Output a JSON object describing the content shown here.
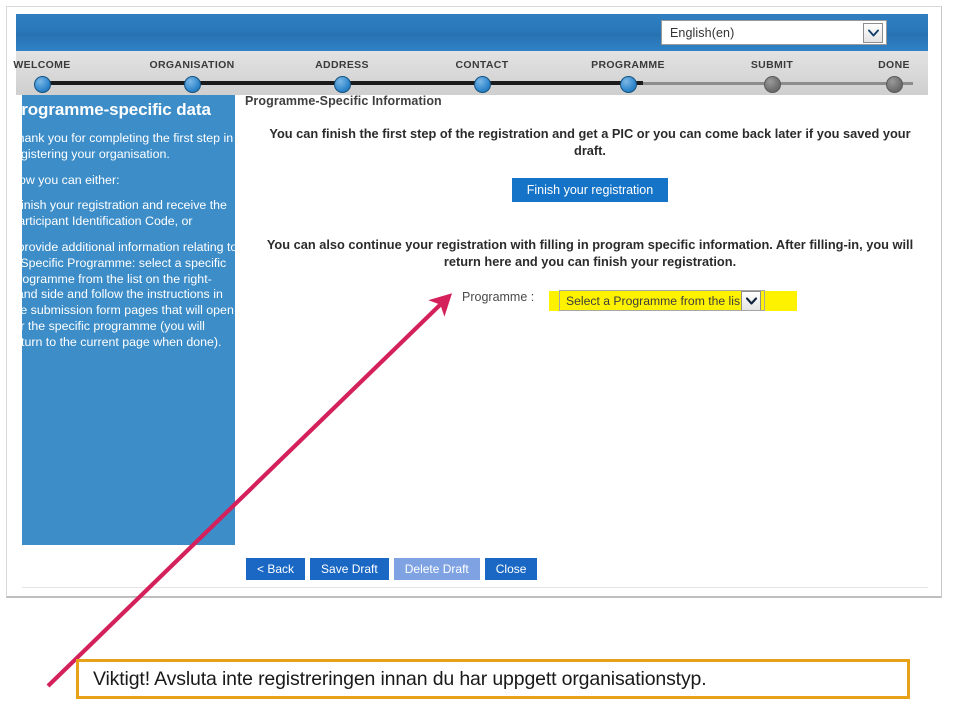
{
  "language_selector": {
    "value": "English(en)",
    "icon": "chevron-down-icon"
  },
  "stepper": {
    "steps": [
      {
        "label": "WELCOME",
        "state": "done"
      },
      {
        "label": "ORGANISATION",
        "state": "done"
      },
      {
        "label": "ADDRESS",
        "state": "done"
      },
      {
        "label": "CONTACT",
        "state": "done"
      },
      {
        "label": "PROGRAMME",
        "state": "done"
      },
      {
        "label": "SUBMIT",
        "state": "todo"
      },
      {
        "label": "DONE",
        "state": "todo"
      }
    ]
  },
  "help_panel": {
    "title": "Programme-specific data",
    "paragraphs": [
      "Thank you for completing the first step in registering your organisation.",
      "Now you can either:",
      "- finish your registration and receive the Participant Identification Code, or",
      "- provide additional information relating to a Specific Programme: select a specific Programme from the list on the right-hand side and follow the instructions in the submission form pages that will open for the specific programme (you will return to the current page when done)."
    ]
  },
  "main": {
    "title": "Programme-Specific Information",
    "paragraph_1": "You can finish the first step of the registration and get a PIC or you can come back later if you saved your draft.",
    "finish_button": "Finish your registration",
    "paragraph_2": "You can also continue your registration with filling in program specific information. After filling-in, you will return here and you can finish your registration.",
    "programme_label": "Programme :",
    "programme_select_value": "Select a Programme from the lis",
    "programme_select_icon": "chevron-down-icon"
  },
  "actions": {
    "buttons": [
      {
        "label": "< Back",
        "state": "enabled"
      },
      {
        "label": "Save Draft",
        "state": "enabled"
      },
      {
        "label": "Delete Draft",
        "state": "disabled"
      },
      {
        "label": "Close",
        "state": "enabled"
      }
    ]
  },
  "annotation": {
    "caption": "Viktigt! Avsluta inte registreringen innan du har uppgett organisationstyp.",
    "arrow_color": "#d4215c",
    "caption_border_color": "#e8a21a",
    "arrow_icon": "arrow-pointer-icon"
  },
  "colors": {
    "banner_blue": "#2a78ba",
    "help_panel_blue": "#3c8dc8",
    "primary_button_blue": "#1573c8",
    "action_button_blue": "#1a68c4",
    "disabled_button_blue": "#7fa3e2",
    "highlight_yellow": "#fff200",
    "step_done": "#2f86cc",
    "step_todo": "#6f6f6f"
  }
}
